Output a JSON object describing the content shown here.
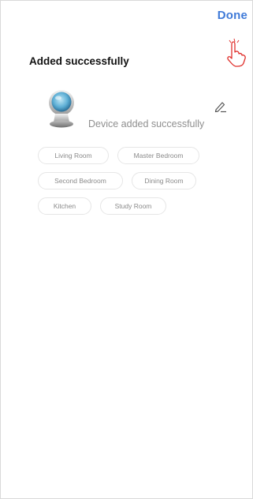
{
  "header": {
    "done_label": "Done"
  },
  "main": {
    "title": "Added successfully",
    "device_status": "Device added successfully"
  },
  "rooms": [
    "Living Room",
    "Master Bedroom",
    "Second Bedroom",
    "Dining Room",
    "Kitchen",
    "Study Room"
  ],
  "colors": {
    "accent": "#3f7ad8",
    "annotation": "#e0302c",
    "chip_text": "#8a8a8a",
    "device_text": "#8f8f8f"
  },
  "icons": {
    "device": "camera-device-icon",
    "edit": "pencil-edit-icon",
    "annotation": "pointing-hand-icon"
  }
}
